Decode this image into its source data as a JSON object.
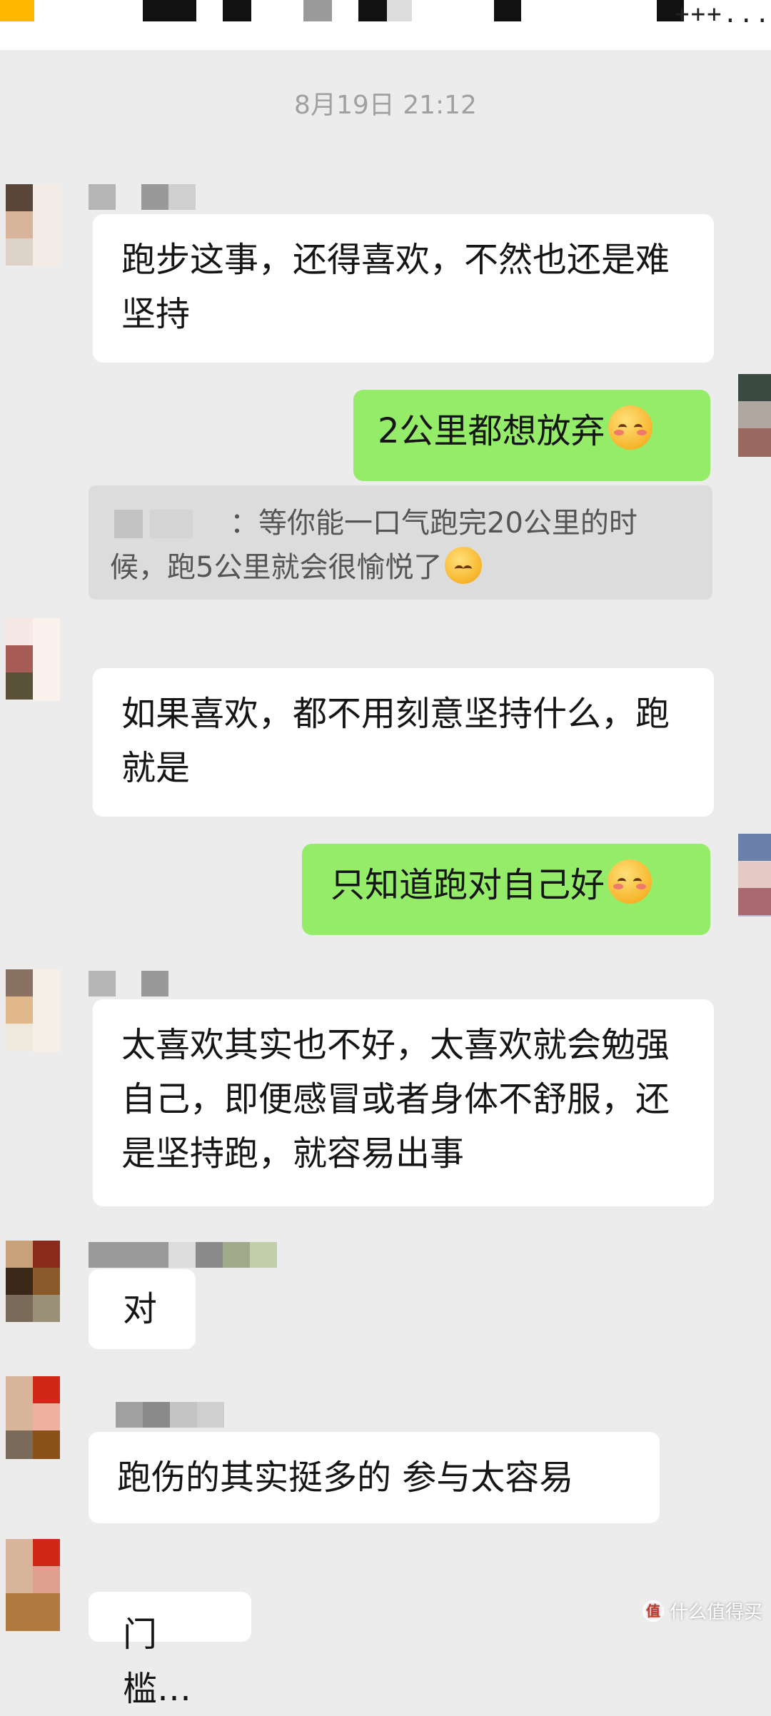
{
  "status_bar": {
    "tail_text": "+++..."
  },
  "timestamp": "8月19日 21:12",
  "messages": [
    {
      "sender": "other",
      "text": "跑步这事，还得喜欢，不然也还是难坚持"
    },
    {
      "sender": "me",
      "text": "2公里都想放弃",
      "emoji": "smiling-blush-emoji"
    },
    {
      "sender": "quote",
      "text": "等你能一口气跑完20公里的时候，跑5公里就会很愉悦了",
      "prefix": "：",
      "emoji": "thinking-face-emoji"
    },
    {
      "sender": "other",
      "text": "如果喜欢，都不用刻意坚持什么，跑就是"
    },
    {
      "sender": "me",
      "text": "只知道跑对自己好",
      "emoji": "smiling-blush-emoji"
    },
    {
      "sender": "other",
      "text": "太喜欢其实也不好，太喜欢就会勉强自己，即便感冒或者身体不舒服，还是坚持跑，就容易出事"
    },
    {
      "sender": "other",
      "text": "对"
    },
    {
      "sender": "other",
      "text": "跑伤的其实挺多的 参与太容易"
    },
    {
      "sender": "other",
      "text": "门槛…"
    }
  ],
  "watermark": {
    "text": "什么值得买",
    "icon": "值"
  },
  "colors": {
    "background": "#ececec",
    "my_bubble": "#95ec69",
    "other_bubble": "#ffffff",
    "quote": "#dcdcdc"
  }
}
